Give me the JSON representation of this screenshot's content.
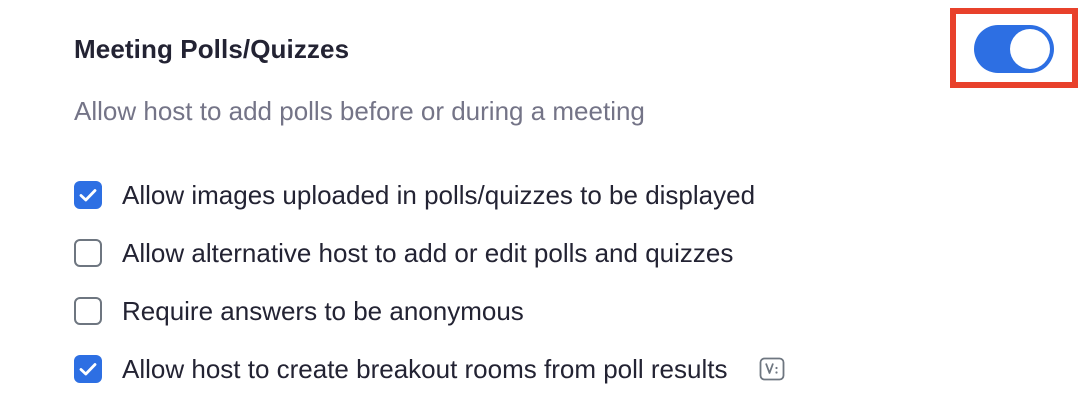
{
  "setting": {
    "title": "Meeting Polls/Quizzes",
    "description": "Allow host to add polls before or during a meeting",
    "enabled": true
  },
  "options": [
    {
      "label": "Allow images uploaded in polls/quizzes to be displayed",
      "checked": true
    },
    {
      "label": "Allow alternative host to add or edit polls and quizzes",
      "checked": false
    },
    {
      "label": "Require answers to be anonymous",
      "checked": false
    },
    {
      "label": "Allow host to create breakout rooms from poll results",
      "checked": true,
      "icon": "v-badge-icon"
    }
  ],
  "colors": {
    "accent": "#2d6fe3",
    "highlight": "#e8412b",
    "description": "#747487",
    "text": "#232333"
  }
}
